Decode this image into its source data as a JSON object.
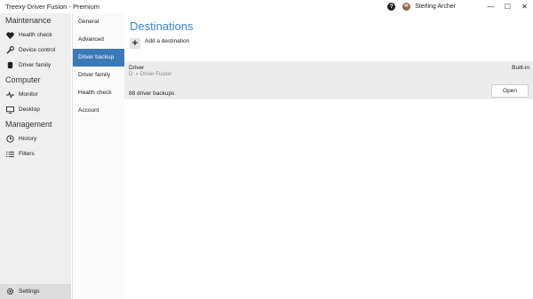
{
  "app": {
    "title": "Treexy Driver Fusion - Premium",
    "user": "Sterling Archer"
  },
  "window_controls": {
    "help": "?",
    "minimize": "—",
    "maximize": "☐",
    "close": "✕"
  },
  "leftnav": {
    "groups": [
      {
        "label": "Maintenance",
        "items": [
          {
            "label": "Health check",
            "icon": "heart-icon"
          },
          {
            "label": "Device control",
            "icon": "wrench-icon"
          },
          {
            "label": "Driver family",
            "icon": "cylinder-icon"
          }
        ]
      },
      {
        "label": "Computer",
        "items": [
          {
            "label": "Monitor",
            "icon": "pulse-icon"
          },
          {
            "label": "Desktop",
            "icon": "monitor-icon"
          }
        ]
      },
      {
        "label": "Management",
        "items": [
          {
            "label": "History",
            "icon": "history-icon"
          },
          {
            "label": "Filters",
            "icon": "list-icon"
          }
        ]
      }
    ],
    "settings": "Settings"
  },
  "subnav": {
    "items": [
      "General",
      "Advanced",
      "Driver backup",
      "Driver family",
      "Health check",
      "Account"
    ],
    "active": "Driver backup"
  },
  "main": {
    "title": "Destinations",
    "add_label": "Add a destination",
    "destination": {
      "name": "Driver",
      "path": "D: » Driver Fusion",
      "type": "Built-in",
      "backups": "88 driver backups",
      "open_label": "Open"
    }
  },
  "colors": {
    "accent": "#3b79b7",
    "title": "#3b86c6",
    "nav_bg": "#efefef"
  }
}
